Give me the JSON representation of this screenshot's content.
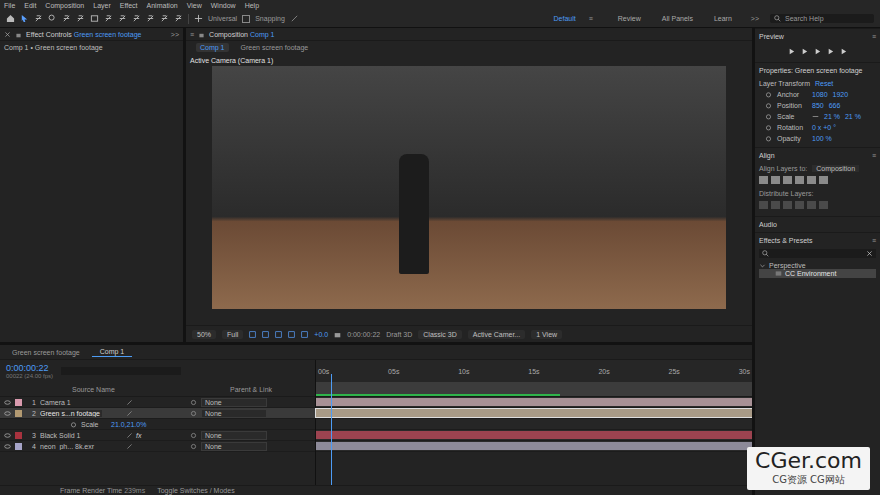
{
  "menu": [
    "File",
    "Edit",
    "Composition",
    "Layer",
    "Effect",
    "Animation",
    "View",
    "Window",
    "Help"
  ],
  "toolbar": {
    "axis_mode": "Universal",
    "snapping": {
      "label": "Snapping",
      "checked": false
    },
    "workspaces": [
      {
        "label": "Default",
        "selected": true
      },
      {
        "label": "Review",
        "selected": false
      },
      {
        "label": "All Panels",
        "selected": false
      },
      {
        "label": "Learn",
        "selected": false
      }
    ],
    "workspace_menu": "≡",
    "more": ">>",
    "search": {
      "placeholder": "Search Help"
    }
  },
  "effect_controls": {
    "tab": "Effect Controls",
    "layer": "Green screen footage",
    "subtitle": "Comp 1 • Green screen footage",
    "more": ">>"
  },
  "composition": {
    "tab": "Composition",
    "comp": "Comp 1",
    "menu": "≡",
    "breadcrumbs": [
      {
        "label": "Comp 1",
        "selected": true
      },
      {
        "label": "Green screen footage",
        "selected": false
      }
    ],
    "view_label": "Active Camera (Camera 1)",
    "viewer_bar": {
      "zoom": "50%",
      "resolution": "Full",
      "exposure": "+0.0",
      "time": "0:00:00:22",
      "draft": "Draft 3D",
      "renderer": "Classic 3D",
      "view": "Active Camer...",
      "views": "1 View"
    }
  },
  "preview": {
    "title": "Preview",
    "menu": "≡"
  },
  "properties": {
    "title": "Properties: Green screen footage",
    "section": "Layer Transform",
    "reset": "Reset",
    "rows": [
      {
        "name": "Anchor",
        "values": [
          "1080",
          "1920"
        ],
        "linked": false
      },
      {
        "name": "Position",
        "values": [
          "850",
          "666"
        ],
        "linked": false
      },
      {
        "name": "Scale",
        "values": [
          "21 %",
          "21 %"
        ],
        "linked": true
      },
      {
        "name": "Rotation",
        "values": [
          "0 x +0 °"
        ],
        "linked": false
      },
      {
        "name": "Opacity",
        "values": [
          "100 %"
        ],
        "linked": false
      }
    ]
  },
  "align": {
    "title": "Align",
    "menu": "≡",
    "align_to_label": "Align Layers to:",
    "align_to": "Composition",
    "distribute": "Distribute Layers:"
  },
  "audio": {
    "title": "Audio"
  },
  "effects_presets": {
    "title": "Effects & Presets",
    "menu": "≡",
    "tree": [
      {
        "label": "Perspective",
        "expanded": true,
        "children": [
          {
            "label": "CC Environment",
            "selected": true
          }
        ]
      }
    ]
  },
  "timeline": {
    "tabs": [
      {
        "label": "Green screen footage",
        "selected": false
      },
      {
        "label": "Comp 1",
        "selected": true
      }
    ],
    "time": "0:00:00:22",
    "frame": "00022 (24.00 fps)",
    "columns": [
      "Source Name",
      "Parent & Link"
    ],
    "fx_label": "fx",
    "layers": [
      {
        "num": "1",
        "name": "Camera 1",
        "parent": "None",
        "selected": false,
        "has_effects": false,
        "color": "#d99aae",
        "bar_color": "#a89196",
        "property": null
      },
      {
        "num": "2",
        "name": "Green s...n footage",
        "parent": "None",
        "selected": true,
        "has_effects": false,
        "color": "#b39a72",
        "bar_color": "#a89a86",
        "property": {
          "name": "Scale",
          "value": "21.0,21.0%"
        }
      },
      {
        "num": "3",
        "name": "Black Solid 1",
        "parent": "None",
        "selected": false,
        "has_effects": true,
        "color": "#a8333f",
        "bar_color": "#9c4350",
        "property": null
      },
      {
        "num": "4",
        "name": "neon_ph... 8k.exr",
        "parent": "None",
        "selected": false,
        "has_effects": false,
        "color": "#a6a4c8",
        "bar_color": "#8d8a99",
        "property": null
      }
    ],
    "ruler": [
      "00s",
      "05s",
      "10s",
      "15s",
      "20s",
      "25s",
      "30s"
    ],
    "playhead": 0.035,
    "cache_level": 0.56
  },
  "status": {
    "render_label": "Frame Render Time",
    "render_time": "239ms",
    "toggle": "Toggle Switches / Modes"
  },
  "watermark": {
    "title": "CGer.com",
    "subtitle": "CG资源 CG网站"
  }
}
